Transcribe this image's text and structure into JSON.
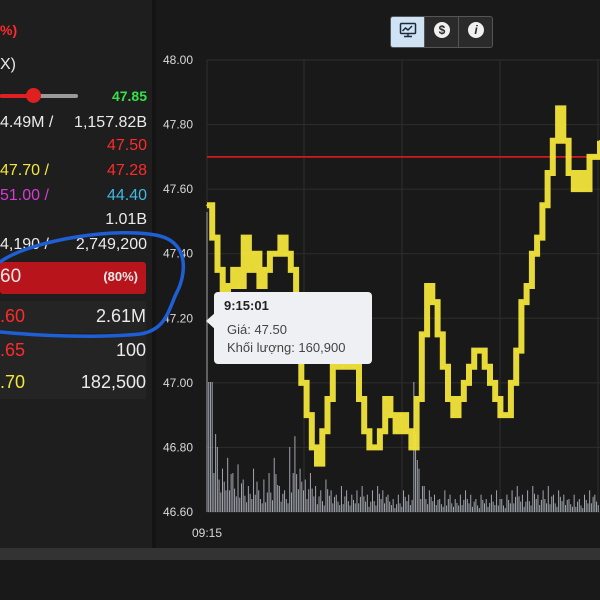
{
  "left_panel": {
    "row1": {
      "left": "%)"
    },
    "row2": {
      "left": "X)"
    },
    "row3": {
      "right": "47.85"
    },
    "row4": {
      "left": "4.49M /",
      "right": "1,157.82B"
    },
    "row5": {
      "right": "47.50"
    },
    "row6": {
      "left": "47.70 /",
      "right": "47.28"
    },
    "row7": {
      "left": "51.00 /",
      "right": "44.40"
    },
    "row8": {
      "right": "1.01B"
    },
    "row9": {
      "left": "4,190 /",
      "right": "2,749,200"
    },
    "row10": {
      "left": "60",
      "right": "(80%)"
    },
    "row11": {
      "left": ".60",
      "right": "2.61M"
    },
    "row12": {
      "left": ".65",
      "right": "100"
    },
    "row13": {
      "left": ".70",
      "right": "182,500"
    },
    "slider_fraction": 0.42
  },
  "toolbar": {
    "buttons": [
      {
        "icon": "chart-monitor-icon",
        "active": true
      },
      {
        "icon": "dollar-icon",
        "active": false
      },
      {
        "icon": "info-icon",
        "active": false
      }
    ]
  },
  "tooltip": {
    "time": "9:15:01",
    "price_line": "Giá: 47.50",
    "volume_line": "Khối lượng: 160,900"
  },
  "colors": {
    "price_line": "#f2e43a",
    "reference_line": "#d11a1a",
    "volume_bars": "#b8bec8",
    "up": "#36e04a",
    "down": "#ff2a2a",
    "annotation": "#1f5fd6"
  },
  "chart_data": {
    "type": "line",
    "title": "",
    "xlabel": "",
    "ylabel": "",
    "x_tick_labels": [
      "09:15"
    ],
    "y_tick_labels": [
      "48.00",
      "47.80",
      "47.60",
      "47.40",
      "47.20",
      "47.00",
      "46.80",
      "46.60"
    ],
    "ylim": [
      46.6,
      48.0
    ],
    "reference_price": 47.7,
    "grid": true,
    "series": [
      {
        "values": [
          47.55,
          47.45,
          47.35,
          47.2,
          47.3,
          47.35,
          47.3,
          47.45,
          47.35,
          47.4,
          47.3,
          47.35,
          47.4,
          47.4,
          47.45,
          47.4,
          47.35,
          47.1,
          47.0,
          46.9,
          46.8,
          46.75,
          46.85,
          46.95,
          47.05,
          47.1,
          47.05,
          47.1,
          47.05,
          46.95,
          46.85,
          46.8,
          46.8,
          46.85,
          46.95,
          46.9,
          46.85,
          46.9,
          46.85,
          46.8,
          46.95,
          47.15,
          47.3,
          47.25,
          47.15,
          47.05,
          46.95,
          46.9,
          46.95,
          47.0,
          47.05,
          47.1,
          47.1,
          47.05,
          47.0,
          46.95,
          46.9,
          46.9,
          47.0,
          47.1,
          47.25,
          47.3,
          47.4,
          47.45,
          47.55,
          47.65,
          47.75,
          47.85,
          47.75,
          47.65,
          47.6,
          47.65,
          47.6,
          47.7,
          47.7,
          47.75
        ]
      }
    ],
    "volume": [
      160900,
      60000,
      30000,
      20000,
      25000,
      18000,
      22000,
      15000,
      12000,
      20000,
      10000,
      15000,
      18000,
      25000,
      12000,
      10000,
      30000,
      35000,
      20000,
      15000,
      18000,
      12000,
      10000,
      15000,
      10000,
      8000,
      12000,
      10000,
      8000,
      10000,
      12000,
      8000,
      10000,
      12000,
      10000,
      8000,
      6000,
      8000,
      10000,
      8000,
      60000,
      20000,
      12000,
      10000,
      8000,
      6000,
      10000,
      8000,
      6000,
      8000,
      10000,
      8000,
      6000,
      8000,
      6000,
      8000,
      10000,
      6000,
      8000,
      10000,
      12000,
      8000,
      10000,
      12000,
      8000,
      10000,
      12000,
      8000,
      10000,
      8000,
      6000,
      8000,
      6000,
      8000,
      10000,
      8000
    ]
  }
}
